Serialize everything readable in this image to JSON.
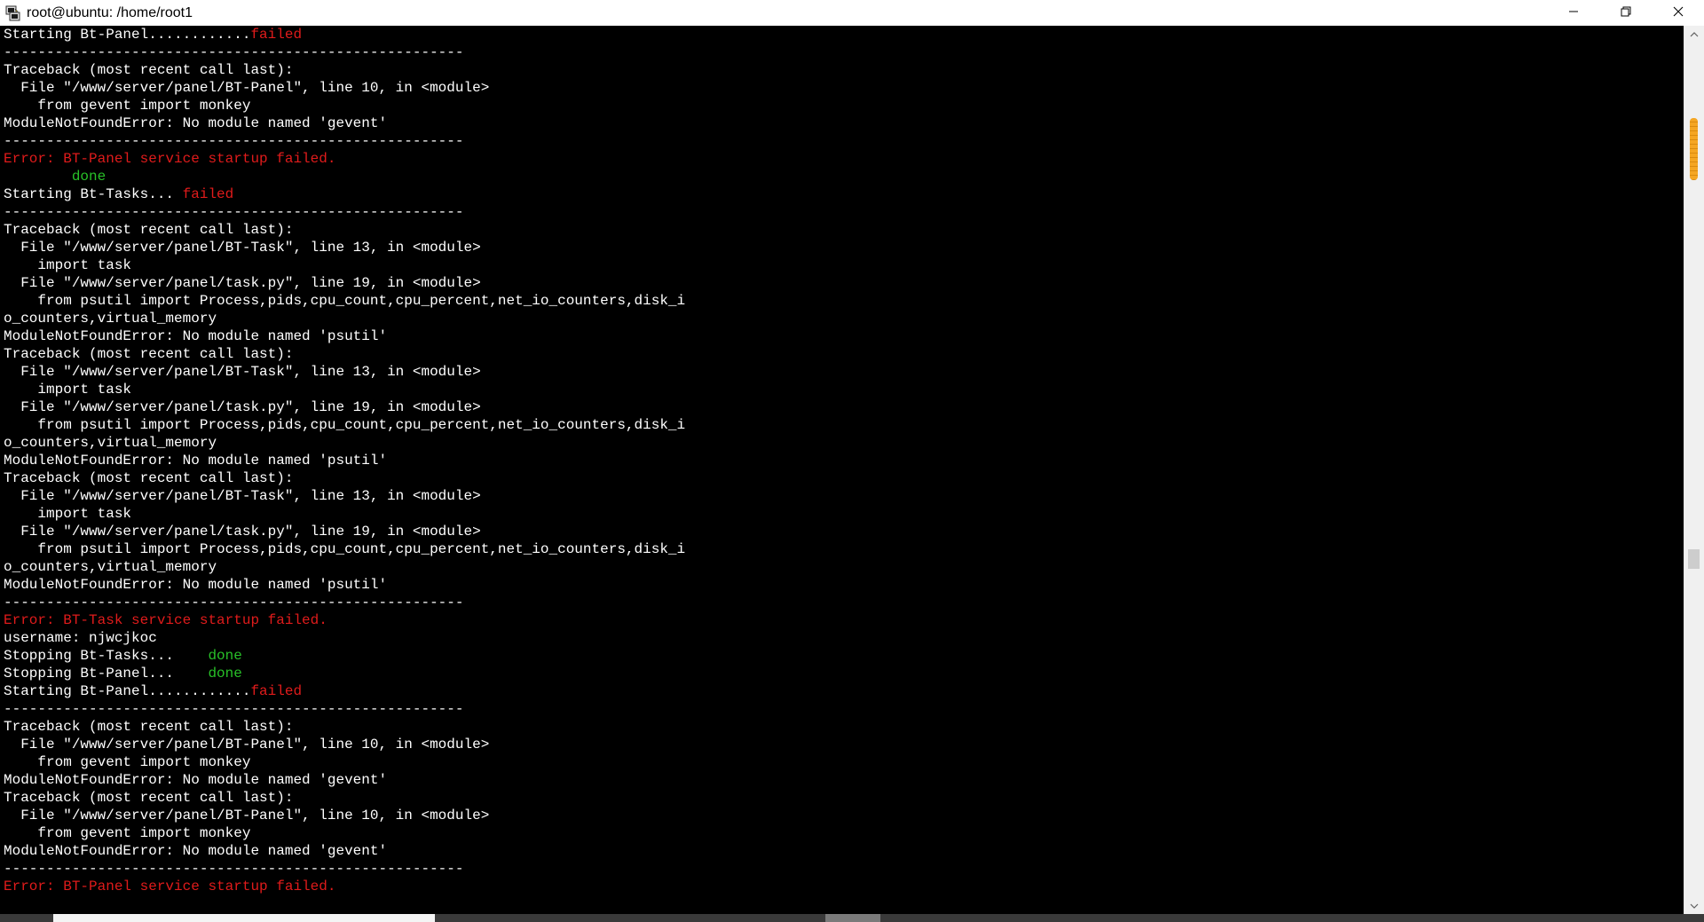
{
  "window": {
    "title": "root@ubuntu: /home/root1",
    "icons": {
      "app": "putty-terminal-icon",
      "minimize": "minimize-icon",
      "maximize": "restore-icon",
      "close": "close-icon"
    }
  },
  "terminal": {
    "colors": {
      "background": "#000000",
      "default": "#ffffff",
      "error": "#e01b1b",
      "success": "#28c028"
    },
    "lines": [
      [
        {
          "t": "Starting Bt-Panel............"
        },
        {
          "t": "failed",
          "c": "red"
        }
      ],
      [
        {
          "t": "------------------------------------------------------"
        }
      ],
      [
        {
          "t": "Traceback (most recent call last):"
        }
      ],
      [
        {
          "t": "  File \"/www/server/panel/BT-Panel\", line 10, in <module>"
        }
      ],
      [
        {
          "t": "    from gevent import monkey"
        }
      ],
      [
        {
          "t": "ModuleNotFoundError: No module named 'gevent'"
        }
      ],
      [
        {
          "t": "------------------------------------------------------"
        }
      ],
      [
        {
          "t": "Error: BT-Panel service startup failed.",
          "c": "red"
        }
      ],
      [
        {
          "t": "        "
        },
        {
          "t": "done",
          "c": "green"
        }
      ],
      [
        {
          "t": "Starting Bt-Tasks... "
        },
        {
          "t": "failed",
          "c": "red"
        }
      ],
      [
        {
          "t": "------------------------------------------------------"
        }
      ],
      [
        {
          "t": "Traceback (most recent call last):"
        }
      ],
      [
        {
          "t": "  File \"/www/server/panel/BT-Task\", line 13, in <module>"
        }
      ],
      [
        {
          "t": "    import task"
        }
      ],
      [
        {
          "t": "  File \"/www/server/panel/task.py\", line 19, in <module>"
        }
      ],
      [
        {
          "t": "    from psutil import Process,pids,cpu_count,cpu_percent,net_io_counters,disk_i"
        }
      ],
      [
        {
          "t": "o_counters,virtual_memory"
        }
      ],
      [
        {
          "t": "ModuleNotFoundError: No module named 'psutil'"
        }
      ],
      [
        {
          "t": "Traceback (most recent call last):"
        }
      ],
      [
        {
          "t": "  File \"/www/server/panel/BT-Task\", line 13, in <module>"
        }
      ],
      [
        {
          "t": "    import task"
        }
      ],
      [
        {
          "t": "  File \"/www/server/panel/task.py\", line 19, in <module>"
        }
      ],
      [
        {
          "t": "    from psutil import Process,pids,cpu_count,cpu_percent,net_io_counters,disk_i"
        }
      ],
      [
        {
          "t": "o_counters,virtual_memory"
        }
      ],
      [
        {
          "t": "ModuleNotFoundError: No module named 'psutil'"
        }
      ],
      [
        {
          "t": "Traceback (most recent call last):"
        }
      ],
      [
        {
          "t": "  File \"/www/server/panel/BT-Task\", line 13, in <module>"
        }
      ],
      [
        {
          "t": "    import task"
        }
      ],
      [
        {
          "t": "  File \"/www/server/panel/task.py\", line 19, in <module>"
        }
      ],
      [
        {
          "t": "    from psutil import Process,pids,cpu_count,cpu_percent,net_io_counters,disk_i"
        }
      ],
      [
        {
          "t": "o_counters,virtual_memory"
        }
      ],
      [
        {
          "t": "ModuleNotFoundError: No module named 'psutil'"
        }
      ],
      [
        {
          "t": "------------------------------------------------------"
        }
      ],
      [
        {
          "t": "Error: BT-Task service startup failed.",
          "c": "red"
        }
      ],
      [
        {
          "t": "username: njwcjkoc"
        }
      ],
      [
        {
          "t": "Stopping Bt-Tasks...    "
        },
        {
          "t": "done",
          "c": "green"
        }
      ],
      [
        {
          "t": "Stopping Bt-Panel...    "
        },
        {
          "t": "done",
          "c": "green"
        }
      ],
      [
        {
          "t": "Starting Bt-Panel............"
        },
        {
          "t": "failed",
          "c": "red"
        }
      ],
      [
        {
          "t": "------------------------------------------------------"
        }
      ],
      [
        {
          "t": "Traceback (most recent call last):"
        }
      ],
      [
        {
          "t": "  File \"/www/server/panel/BT-Panel\", line 10, in <module>"
        }
      ],
      [
        {
          "t": "    from gevent import monkey"
        }
      ],
      [
        {
          "t": "ModuleNotFoundError: No module named 'gevent'"
        }
      ],
      [
        {
          "t": "Traceback (most recent call last):"
        }
      ],
      [
        {
          "t": "  File \"/www/server/panel/BT-Panel\", line 10, in <module>"
        }
      ],
      [
        {
          "t": "    from gevent import monkey"
        }
      ],
      [
        {
          "t": "ModuleNotFoundError: No module named 'gevent'"
        }
      ],
      [
        {
          "t": "------------------------------------------------------"
        }
      ],
      [
        {
          "t": "Error: BT-Panel service startup failed.",
          "c": "red"
        }
      ]
    ]
  }
}
